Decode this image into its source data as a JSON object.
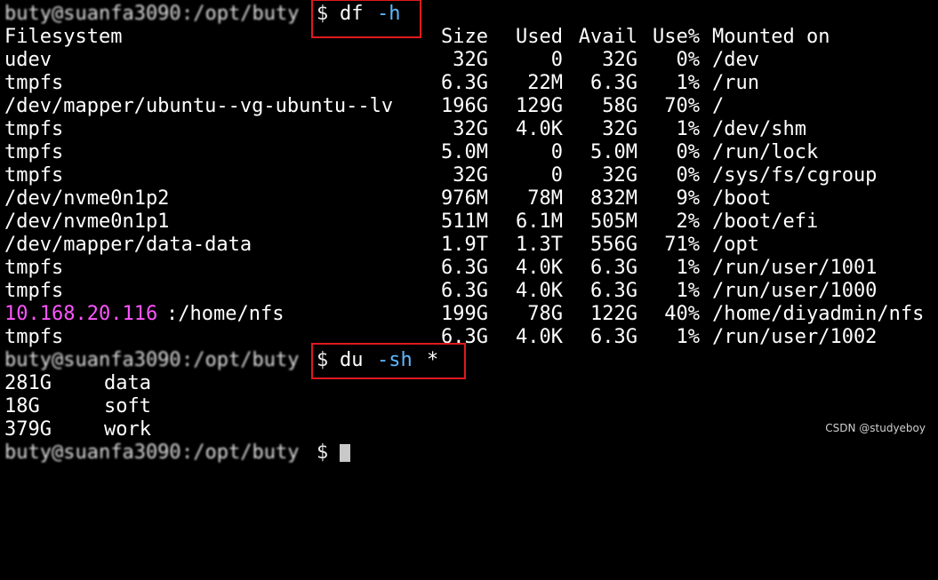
{
  "prompt1": {
    "user_host": "buty@suanfa3090",
    "path": ":/opt/buty",
    "symbol": "$",
    "command": "df",
    "flag": "-h"
  },
  "df_header": {
    "filesystem": "Filesystem",
    "size": "Size",
    "used": "Used",
    "avail": "Avail",
    "use_pct": "Use%",
    "mounted": "Mounted on"
  },
  "df_rows": [
    {
      "fs": "udev",
      "fs_ip": "",
      "size": "32G",
      "used": "0",
      "avail": "32G",
      "use": "0%",
      "mount": "/dev"
    },
    {
      "fs": "tmpfs",
      "fs_ip": "",
      "size": "6.3G",
      "used": "22M",
      "avail": "6.3G",
      "use": "1%",
      "mount": "/run"
    },
    {
      "fs": "/dev/mapper/ubuntu--vg-ubuntu--lv",
      "fs_ip": "",
      "size": "196G",
      "used": "129G",
      "avail": "58G",
      "use": "70%",
      "mount": "/"
    },
    {
      "fs": "tmpfs",
      "fs_ip": "",
      "size": "32G",
      "used": "4.0K",
      "avail": "32G",
      "use": "1%",
      "mount": "/dev/shm"
    },
    {
      "fs": "tmpfs",
      "fs_ip": "",
      "size": "5.0M",
      "used": "0",
      "avail": "5.0M",
      "use": "0%",
      "mount": "/run/lock"
    },
    {
      "fs": "tmpfs",
      "fs_ip": "",
      "size": "32G",
      "used": "0",
      "avail": "32G",
      "use": "0%",
      "mount": "/sys/fs/cgroup"
    },
    {
      "fs": "/dev/nvme0n1p2",
      "fs_ip": "",
      "size": "976M",
      "used": "78M",
      "avail": "832M",
      "use": "9%",
      "mount": "/boot"
    },
    {
      "fs": "/dev/nvme0n1p1",
      "fs_ip": "",
      "size": "511M",
      "used": "6.1M",
      "avail": "505M",
      "use": "2%",
      "mount": "/boot/efi"
    },
    {
      "fs": "/dev/mapper/data-data",
      "fs_ip": "",
      "size": "1.9T",
      "used": "1.3T",
      "avail": "556G",
      "use": "71%",
      "mount": "/opt"
    },
    {
      "fs": "tmpfs",
      "fs_ip": "",
      "size": "6.3G",
      "used": "4.0K",
      "avail": "6.3G",
      "use": "1%",
      "mount": "/run/user/1001"
    },
    {
      "fs": "tmpfs",
      "fs_ip": "",
      "size": "6.3G",
      "used": "4.0K",
      "avail": "6.3G",
      "use": "1%",
      "mount": "/run/user/1000"
    },
    {
      "fs": ":/home/nfs",
      "fs_ip": "10.168.20.116",
      "size": "199G",
      "used": "78G",
      "avail": "122G",
      "use": "40%",
      "mount": "/home/diyadmin/nfs"
    },
    {
      "fs": "tmpfs",
      "fs_ip": "",
      "size": "6.3G",
      "used": "4.0K",
      "avail": "6.3G",
      "use": "1%",
      "mount": "/run/user/1002"
    }
  ],
  "prompt2": {
    "user_host": "buty@suanfa3090",
    "path": ":/opt/buty",
    "symbol": "$",
    "command": "du",
    "flag": "-sh",
    "arg": "*"
  },
  "du_rows": [
    {
      "size": "281G",
      "name": "data"
    },
    {
      "size": "18G",
      "name": "soft"
    },
    {
      "size": "379G",
      "name": "work"
    }
  ],
  "prompt3": {
    "user_host": "buty@suanfa3090",
    "path": ":/opt/buty",
    "symbol": "$"
  },
  "watermark": "CSDN @studyeboy",
  "colors": {
    "background": "#000000",
    "text": "#ffffff",
    "flag": "#5fb8ff",
    "ip": "#ff55ff",
    "highlight_border": "#e0191d"
  }
}
